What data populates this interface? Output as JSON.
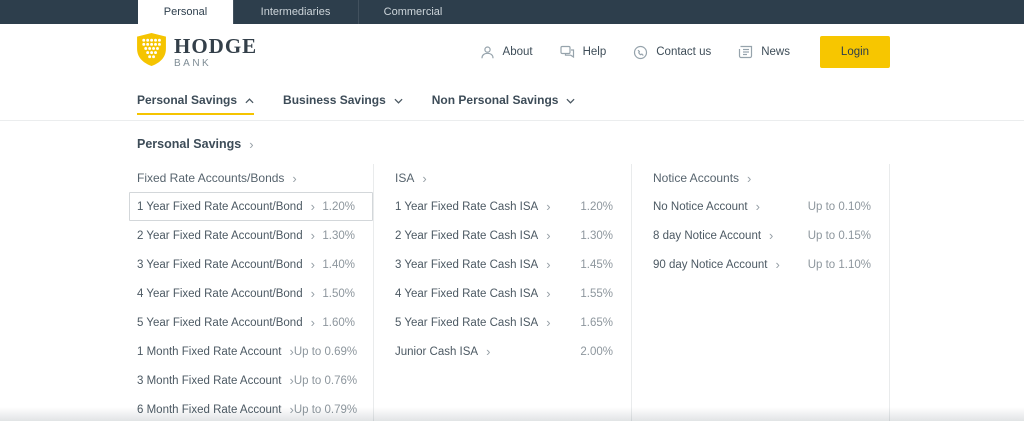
{
  "top_bar": {
    "tabs": [
      {
        "label": "Personal",
        "active": true
      },
      {
        "label": "Intermediaries",
        "active": false
      },
      {
        "label": "Commercial",
        "active": false
      }
    ]
  },
  "header": {
    "logo": {
      "name": "HODGE",
      "sub": "BANK"
    },
    "nav": [
      {
        "label": "About",
        "icon": "user-icon"
      },
      {
        "label": "Help",
        "icon": "chat-icon"
      },
      {
        "label": "Contact us",
        "icon": "phone-icon"
      },
      {
        "label": "News",
        "icon": "news-icon"
      }
    ],
    "login_label": "Login"
  },
  "secondary_nav": [
    {
      "label": "Personal Savings",
      "expanded": true
    },
    {
      "label": "Business Savings",
      "expanded": false
    },
    {
      "label": "Non Personal Savings",
      "expanded": false
    }
  ],
  "mega_menu": {
    "title": "Personal Savings",
    "columns": [
      {
        "heading": "Fixed Rate Accounts/Bonds",
        "items": [
          {
            "label": "1 Year Fixed Rate Account/Bond",
            "rate": "1.20%",
            "focused": true
          },
          {
            "label": "2 Year Fixed Rate Account/Bond",
            "rate": "1.30%"
          },
          {
            "label": "3 Year Fixed Rate Account/Bond",
            "rate": "1.40%"
          },
          {
            "label": "4 Year Fixed Rate Account/Bond",
            "rate": "1.50%"
          },
          {
            "label": "5 Year Fixed Rate Account/Bond",
            "rate": "1.60%"
          },
          {
            "label": "1 Month Fixed Rate Account",
            "rate": "Up to 0.69%"
          },
          {
            "label": "3 Month Fixed Rate Account",
            "rate": "Up to 0.76%"
          },
          {
            "label": "6 Month Fixed Rate Account",
            "rate": "Up to 0.79%"
          }
        ]
      },
      {
        "heading": "ISA",
        "items": [
          {
            "label": "1 Year Fixed Rate Cash ISA",
            "rate": "1.20%"
          },
          {
            "label": "2 Year Fixed Rate Cash ISA",
            "rate": "1.30%"
          },
          {
            "label": "3 Year Fixed Rate Cash ISA",
            "rate": "1.45%"
          },
          {
            "label": "4 Year Fixed Rate Cash ISA",
            "rate": "1.55%"
          },
          {
            "label": "5 Year Fixed Rate Cash ISA",
            "rate": "1.65%"
          },
          {
            "label": "Junior Cash ISA",
            "rate": "2.00%"
          }
        ]
      },
      {
        "heading": "Notice Accounts",
        "items": [
          {
            "label": "No Notice Account",
            "rate": "Up to 0.10%"
          },
          {
            "label": "8 day Notice Account",
            "rate": "Up to 0.15%"
          },
          {
            "label": "90 day Notice Account",
            "rate": "Up to 1.10%"
          }
        ]
      }
    ]
  },
  "icons": {
    "chevron_right": "›"
  },
  "colors": {
    "brand_yellow": "#F5C400",
    "login_yellow": "#F7C600",
    "dark_slate": "#2D3E4C",
    "rate_text": "#8D969D"
  }
}
